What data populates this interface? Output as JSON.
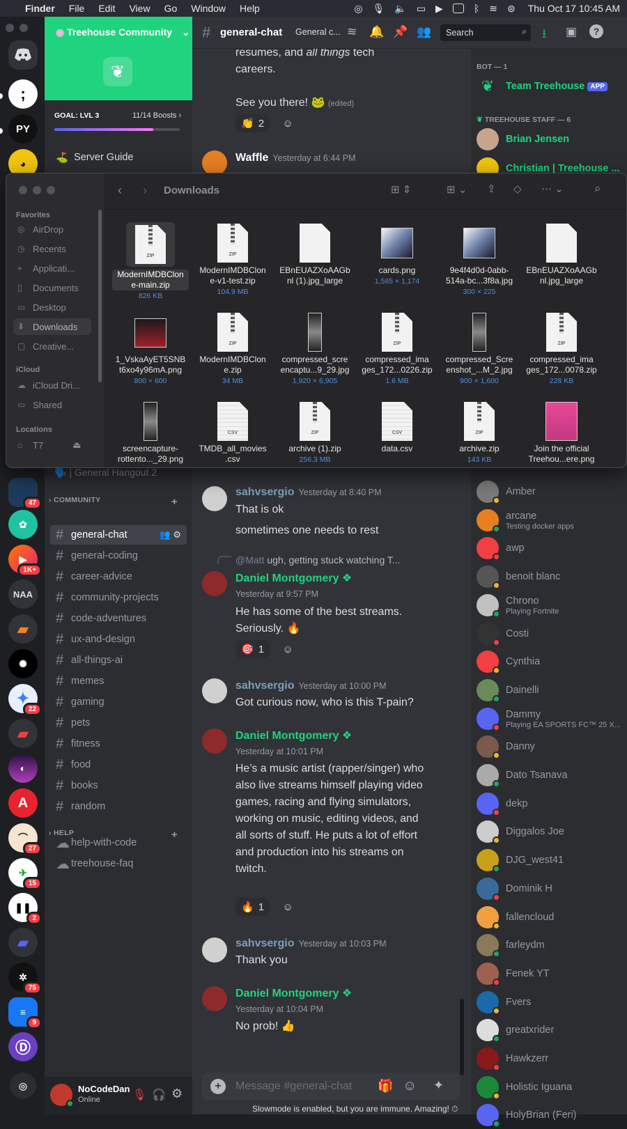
{
  "menubar": {
    "app": "Finder",
    "items": [
      "File",
      "Edit",
      "View",
      "Go",
      "Window",
      "Help"
    ],
    "clock": "Thu Oct 17  10:45 AM"
  },
  "server": {
    "name": "Treehouse Community",
    "goal_label": "GOAL: LVL 3",
    "boosts": "11/14 Boosts",
    "boost_progress": 0.79,
    "server_guide": "Server Guide",
    "partial_channel": "🗣️ | General Hangout 2"
  },
  "rail_badges": {
    "b1": "47",
    "b2": "1K+",
    "naa": "NAA",
    "b3": "22",
    "b4": "27",
    "b5": "15",
    "b6": "2",
    "b7": "75",
    "b8": "9"
  },
  "categories": {
    "community": "COMMUNITY",
    "help": "HELP"
  },
  "channels": [
    "general-chat",
    "general-coding",
    "career-advice",
    "community-projects",
    "code-adventures",
    "ux-and-design",
    "all-things-ai",
    "memes",
    "gaming",
    "pets",
    "fitness",
    "food",
    "books",
    "random"
  ],
  "help_channels": [
    "help-with-code",
    "treehouse-faq"
  ],
  "user": {
    "name": "NoCodeDan",
    "status": "Online"
  },
  "header": {
    "channel": "general-chat",
    "topic": "General c...",
    "search_placeholder": "Search"
  },
  "top_messages": {
    "line1": "resumes, and",
    "line1_em": "all things",
    "line1_end": "tech",
    "line2": "careers.",
    "line3": "See you there! 🐸",
    "edited": "(edited)",
    "react_count": "2",
    "waffle_name": "Waffle",
    "waffle_time": "Yesterday at 6:44 PM"
  },
  "messages": [
    {
      "author": "sahvsergio",
      "time": "Yesterday at 8:40 PM",
      "lines": [
        "That is ok",
        "sometimes one needs to rest"
      ]
    },
    {
      "reply_to": "@Matt",
      "reply_text": "ugh, getting stuck watching T...",
      "author": "Daniel Montgomery",
      "time": "Yesterday at 9:57 PM",
      "text": "He has some of the best streams. Seriously. 🔥",
      "react": "🎯",
      "react_count": "1"
    },
    {
      "author": "sahvsergio",
      "time": "Yesterday at 10:00 PM",
      "text": "Got curious now, who is this T-pain?"
    },
    {
      "author": "Daniel Montgomery",
      "time": "Yesterday at 10:01 PM",
      "text": "He’s a music artist (rapper/singer) who also live streams himself playing video games, racing and flying simulators, working on music, editing videos, and all sorts of stuff. He puts a lot of effort and production into his streams on twitch.",
      "react": "🔥",
      "react_count": "1"
    },
    {
      "author": "sahvsergio",
      "time": "Yesterday at 10:03 PM",
      "text": "Thank you"
    },
    {
      "author": "Daniel Montgomery",
      "time": "Yesterday at 10:04 PM",
      "text": "No prob! 👍"
    }
  ],
  "composer": {
    "placeholder": "Message #general-chat",
    "slowmode": "Slowmode is enabled, but you are immune. Amazing! ⏱"
  },
  "member_list": {
    "bot_header": "BOT — 1",
    "bot": "Team Treehouse",
    "app_tag": "APP",
    "staff_header": "TREEHOUSE STAFF — 6",
    "staff": [
      "Brian Jensen",
      "Christian | Treehouse ..."
    ],
    "members": [
      {
        "name": "Amber",
        "status": ""
      },
      {
        "name": "arcane",
        "status": "Testing docker apps"
      },
      {
        "name": "awp",
        "status": ""
      },
      {
        "name": "benoit blanc",
        "status": ""
      },
      {
        "name": "Chrono",
        "status": "Playing Fortnite"
      },
      {
        "name": "Costi",
        "status": ""
      },
      {
        "name": "Cynthia",
        "status": ""
      },
      {
        "name": "Dainelli",
        "status": ""
      },
      {
        "name": "Dammy",
        "status": "Playing EA SPORTS FC™ 25 X..."
      },
      {
        "name": "Danny",
        "status": ""
      },
      {
        "name": "Dato Tsanava",
        "status": ""
      },
      {
        "name": "dekp",
        "status": ""
      },
      {
        "name": "Diggalos Joe",
        "status": ""
      },
      {
        "name": "DJG_west41",
        "status": ""
      },
      {
        "name": "Dominik H",
        "status": ""
      },
      {
        "name": "fallencloud",
        "status": ""
      },
      {
        "name": "farleydm",
        "status": ""
      },
      {
        "name": "Fenek YT",
        "status": ""
      },
      {
        "name": "Fvers",
        "status": ""
      },
      {
        "name": "greatxrider",
        "status": ""
      },
      {
        "name": "Hawkzerr",
        "status": ""
      },
      {
        "name": "Holistic Iguana",
        "status": ""
      },
      {
        "name": "HolyBrian (Feri)",
        "status": ""
      }
    ]
  },
  "finder": {
    "title": "Downloads",
    "favorites_label": "Favorites",
    "favorites": [
      "AirDrop",
      "Recents",
      "Applicati...",
      "Documents",
      "Desktop",
      "Downloads",
      "Creative..."
    ],
    "icloud_label": "iCloud",
    "icloud": [
      "iCloud Dri...",
      "Shared"
    ],
    "locations_label": "Locations",
    "locations": [
      "T7"
    ],
    "files": [
      {
        "name": "ModernIMDBClone-main.zip",
        "l1": "ModernIMDBClon",
        "l2": "e-main.zip",
        "meta": "826 KB",
        "kind": "zip"
      },
      {
        "l1": "ModernIMDBClon",
        "l2": "e-v1-test.zip",
        "meta": "104.9 MB",
        "kind": "zip"
      },
      {
        "l1": "EBnEUAZXoAAGb",
        "l2": "nl (1).jpg_large",
        "meta": "",
        "kind": "blank"
      },
      {
        "l1": "cards.png",
        "l2": "",
        "meta": "1,565 × 1,174",
        "kind": "img"
      },
      {
        "l1": "9e4f4d0d-0abb-",
        "l2": "514a-bc...3f8a.jpg",
        "meta": "300 × 225",
        "kind": "img"
      },
      {
        "l1": "EBnEUAZXoAAGb",
        "l2": "nl.jpg_large",
        "meta": "",
        "kind": "blank"
      },
      {
        "l1": "1_VskaAyET5SNB",
        "l2": "t6xo4y96mA.png",
        "meta": "800 × 600",
        "kind": "img"
      },
      {
        "l1": "ModernIMDBClon",
        "l2": "e.zip",
        "meta": "34 MB",
        "kind": "zip"
      },
      {
        "l1": "compressed_scre",
        "l2": "encaptu...9_29.jpg",
        "meta": "1,920 × 6,905",
        "kind": "tall"
      },
      {
        "l1": "compressed_ima",
        "l2": "ges_172...0226.zip",
        "meta": "1.6 MB",
        "kind": "zip"
      },
      {
        "l1": "compressed_Scre",
        "l2": "enshot_...M_2.jpg",
        "meta": "900 × 1,600",
        "kind": "tall"
      },
      {
        "l1": "compressed_ima",
        "l2": "ges_172...0078.zip",
        "meta": "228 KB",
        "kind": "zip"
      },
      {
        "l1": "screencapture-",
        "l2": "rottento..._29.png",
        "meta": "",
        "kind": "tall"
      },
      {
        "l1": "TMDB_all_movies",
        "l2": ".csv",
        "meta": "",
        "kind": "csv"
      },
      {
        "l1": "archive (1).zip",
        "l2": "",
        "meta": "256.3 MB",
        "kind": "zip"
      },
      {
        "l1": "data.csv",
        "l2": "",
        "meta": "",
        "kind": "csv"
      },
      {
        "l1": "archive.zip",
        "l2": "",
        "meta": "143 KB",
        "kind": "zip"
      },
      {
        "l1": "Join the official",
        "l2": "Treehou...ere.png",
        "meta": "",
        "kind": "img"
      }
    ]
  },
  "colors": {
    "treehouse_green": "#1fd37f",
    "discord_blurple": "#5865f2",
    "online": "#23a55a",
    "dnd": "#f23f43"
  }
}
